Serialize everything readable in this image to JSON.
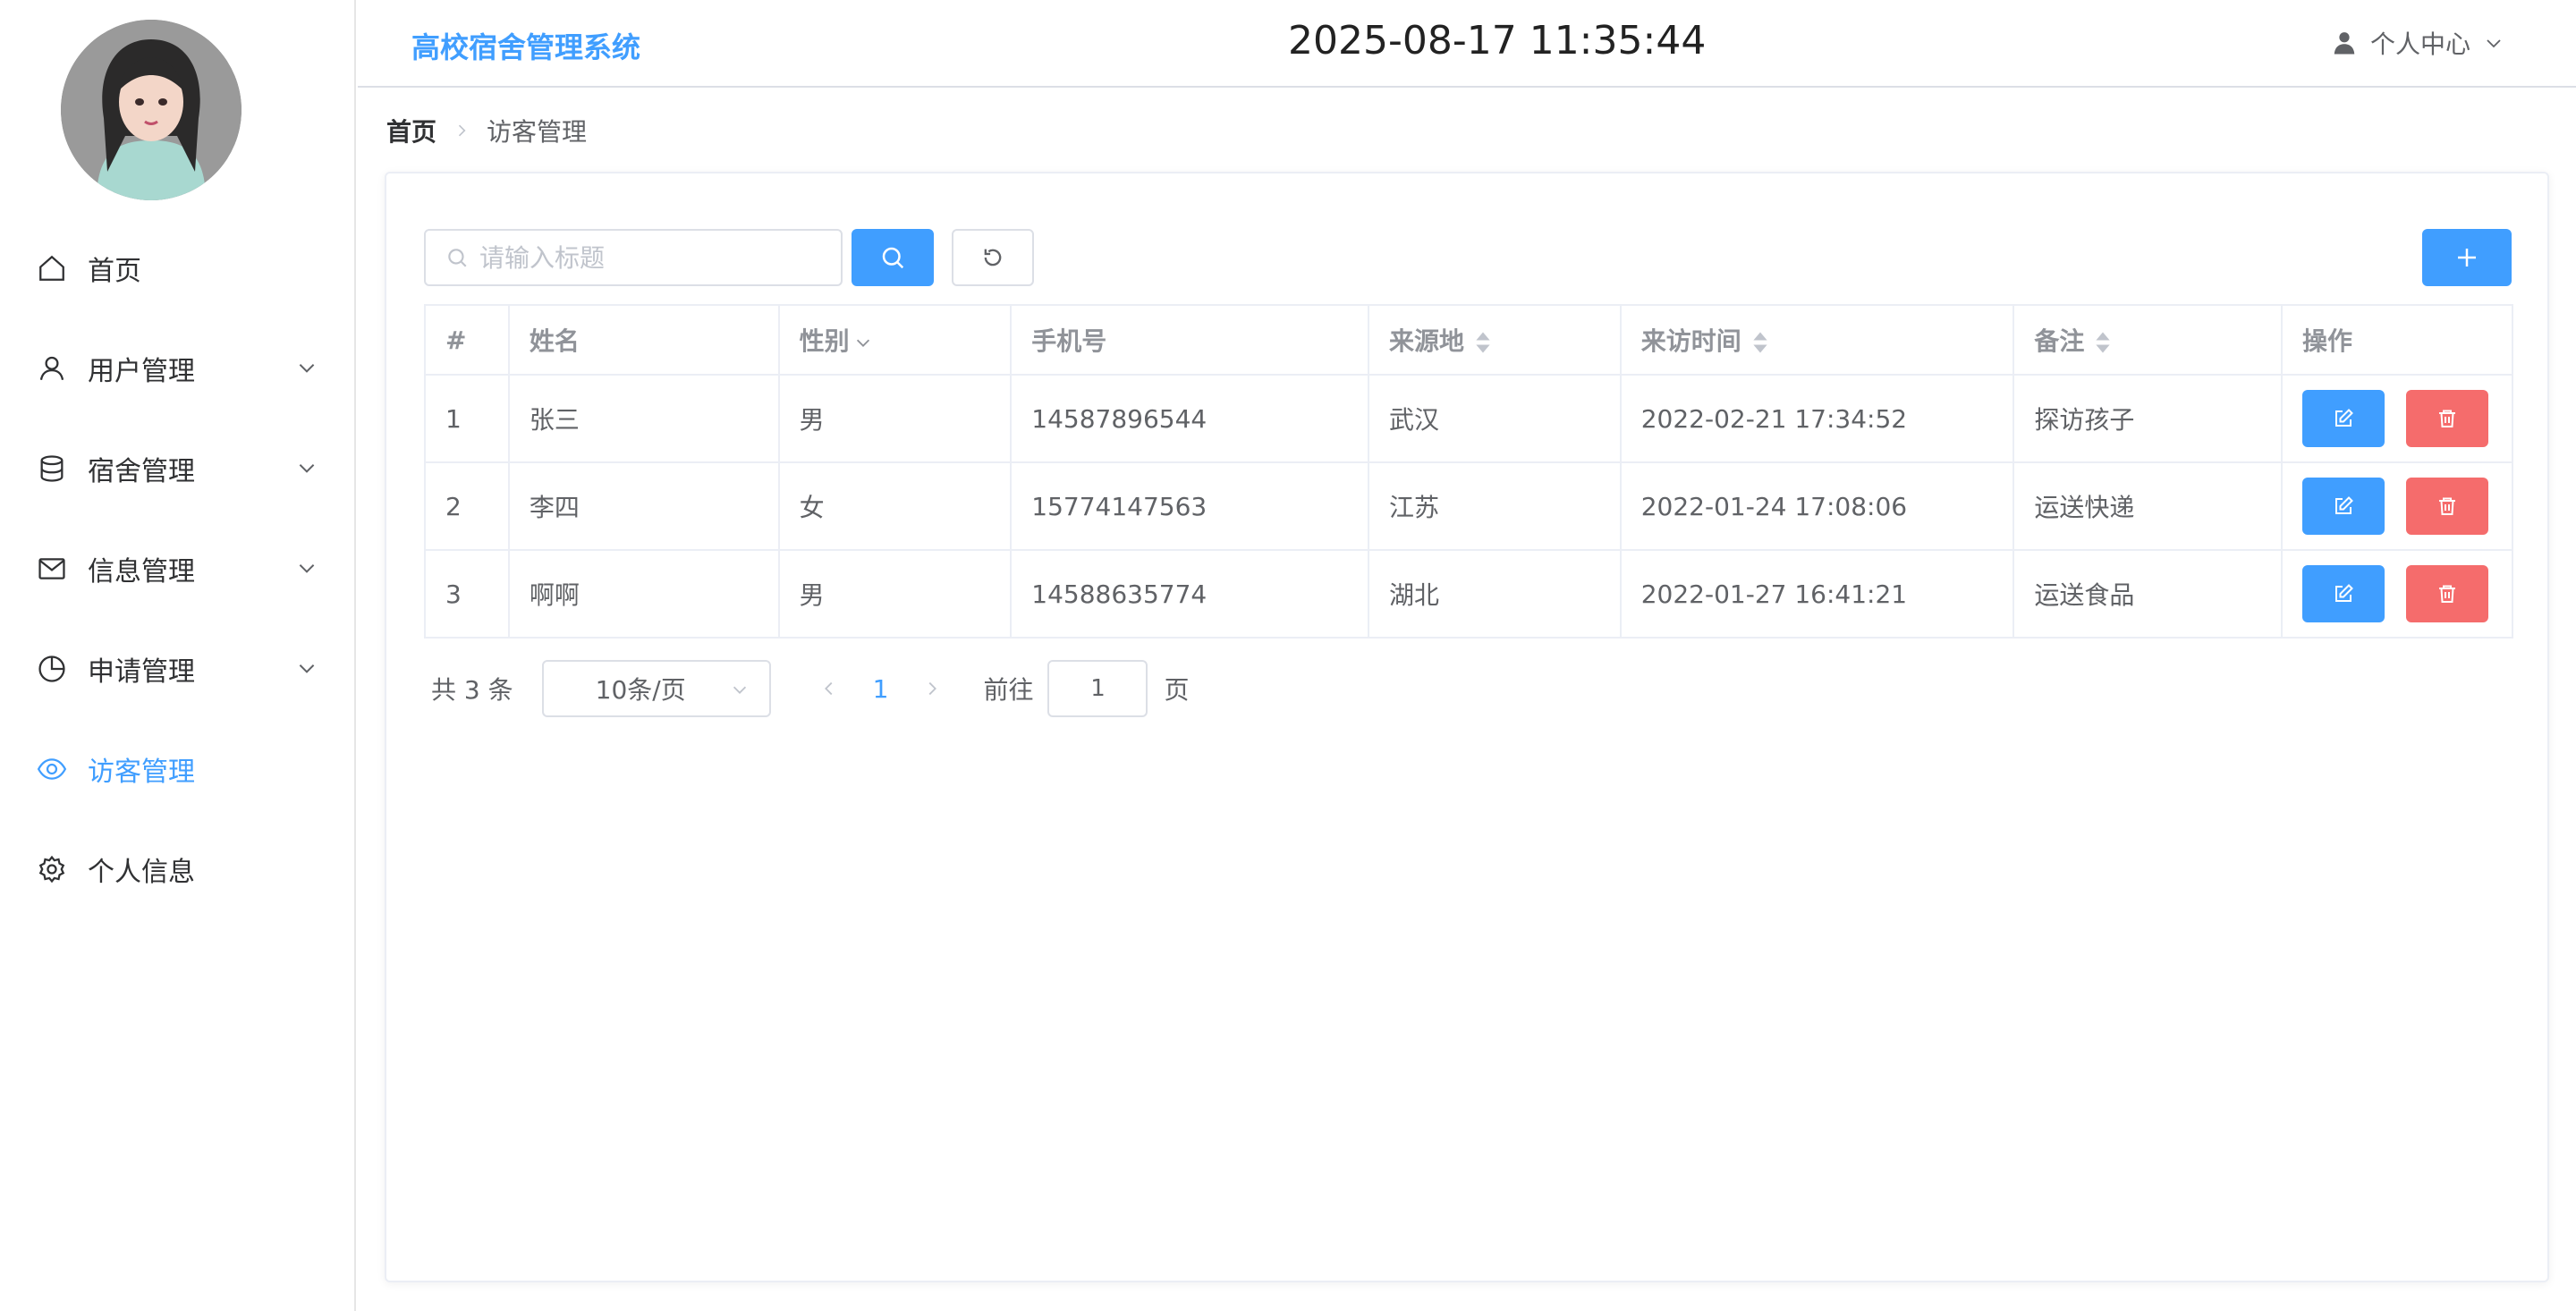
{
  "header": {
    "system_title": "高校宿舍管理系统",
    "datetime": "2025-08-17 11:35:44",
    "user_menu_label": "个人中心"
  },
  "sidebar": {
    "items": [
      {
        "label": "首页",
        "icon": "home-icon"
      },
      {
        "label": "用户管理",
        "icon": "user-icon"
      },
      {
        "label": "宿舍管理",
        "icon": "database-icon"
      },
      {
        "label": "信息管理",
        "icon": "mail-icon"
      },
      {
        "label": "申请管理",
        "icon": "pie-chart-icon"
      },
      {
        "label": "访客管理",
        "icon": "eye-icon"
      },
      {
        "label": "个人信息",
        "icon": "gear-icon"
      }
    ],
    "active_index": 5
  },
  "breadcrumb": {
    "home": "首页",
    "current": "访客管理"
  },
  "search": {
    "placeholder": "请输入标题",
    "value": ""
  },
  "table": {
    "columns": [
      "#",
      "姓名",
      "性别",
      "手机号",
      "来源地",
      "来访时间",
      "备注",
      "操作"
    ],
    "rows": [
      {
        "index": "1",
        "name": "张三",
        "gender": "男",
        "phone": "14587896544",
        "origin": "武汉",
        "visit_time": "2022-02-21 17:34:52",
        "note": "探访孩子"
      },
      {
        "index": "2",
        "name": "李四",
        "gender": "女",
        "phone": "15774147563",
        "origin": "江苏",
        "visit_time": "2022-01-24 17:08:06",
        "note": "运送快递"
      },
      {
        "index": "3",
        "name": "啊啊",
        "gender": "男",
        "phone": "14588635774",
        "origin": "湖北",
        "visit_time": "2022-01-27 16:41:21",
        "note": "运送食品"
      }
    ]
  },
  "pagination": {
    "total_text": "共 3 条",
    "page_size": "10条/页",
    "current_page": "1",
    "goto_label": "前往",
    "goto_value": "1",
    "page_unit": "页"
  },
  "colors": {
    "primary": "#409eff",
    "danger": "#f56c6c",
    "border": "#ebeef5"
  }
}
